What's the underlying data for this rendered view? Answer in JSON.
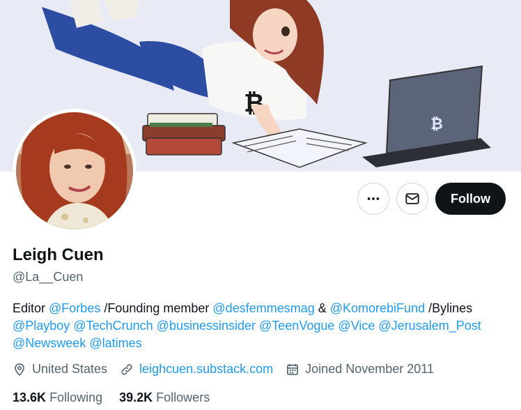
{
  "profile": {
    "name": "Leigh Cuen",
    "handle": "@La__Cuen"
  },
  "actions": {
    "more_icon": "more-horizontal-icon",
    "message_icon": "envelope-icon",
    "follow_label": "Follow"
  },
  "bio": {
    "segments": [
      {
        "text": "Editor ",
        "mention": false
      },
      {
        "text": "@Forbes",
        "mention": true
      },
      {
        "text": " /Founding member ",
        "mention": false
      },
      {
        "text": "@desfemmesmag",
        "mention": true
      },
      {
        "text": " & ",
        "mention": false
      },
      {
        "text": "@KomorebiFund",
        "mention": true
      },
      {
        "text": " /Bylines ",
        "mention": false
      },
      {
        "text": "@Playboy",
        "mention": true
      },
      {
        "text": " ",
        "mention": false
      },
      {
        "text": "@TechCrunch",
        "mention": true
      },
      {
        "text": " ",
        "mention": false
      },
      {
        "text": "@businessinsider",
        "mention": true
      },
      {
        "text": " ",
        "mention": false
      },
      {
        "text": "@TeenVogue",
        "mention": true
      },
      {
        "text": " ",
        "mention": false
      },
      {
        "text": "@Vice",
        "mention": true
      },
      {
        "text": " ",
        "mention": false
      },
      {
        "text": "@Jerusalem_Post",
        "mention": true
      },
      {
        "text": " ",
        "mention": false
      },
      {
        "text": "@Newsweek",
        "mention": true
      },
      {
        "text": " ",
        "mention": false
      },
      {
        "text": "@latimes",
        "mention": true
      }
    ]
  },
  "meta": {
    "location": "United States",
    "website": "leighcuen.substack.com",
    "joined": "Joined November 2011"
  },
  "stats": {
    "following_count": "13.6K",
    "following_label": "Following",
    "followers_count": "39.2K",
    "followers_label": "Followers"
  },
  "colors": {
    "accent": "#1d9bf0",
    "text": "#0f1419",
    "secondary": "#536471",
    "follow_bg": "#0f1419"
  }
}
